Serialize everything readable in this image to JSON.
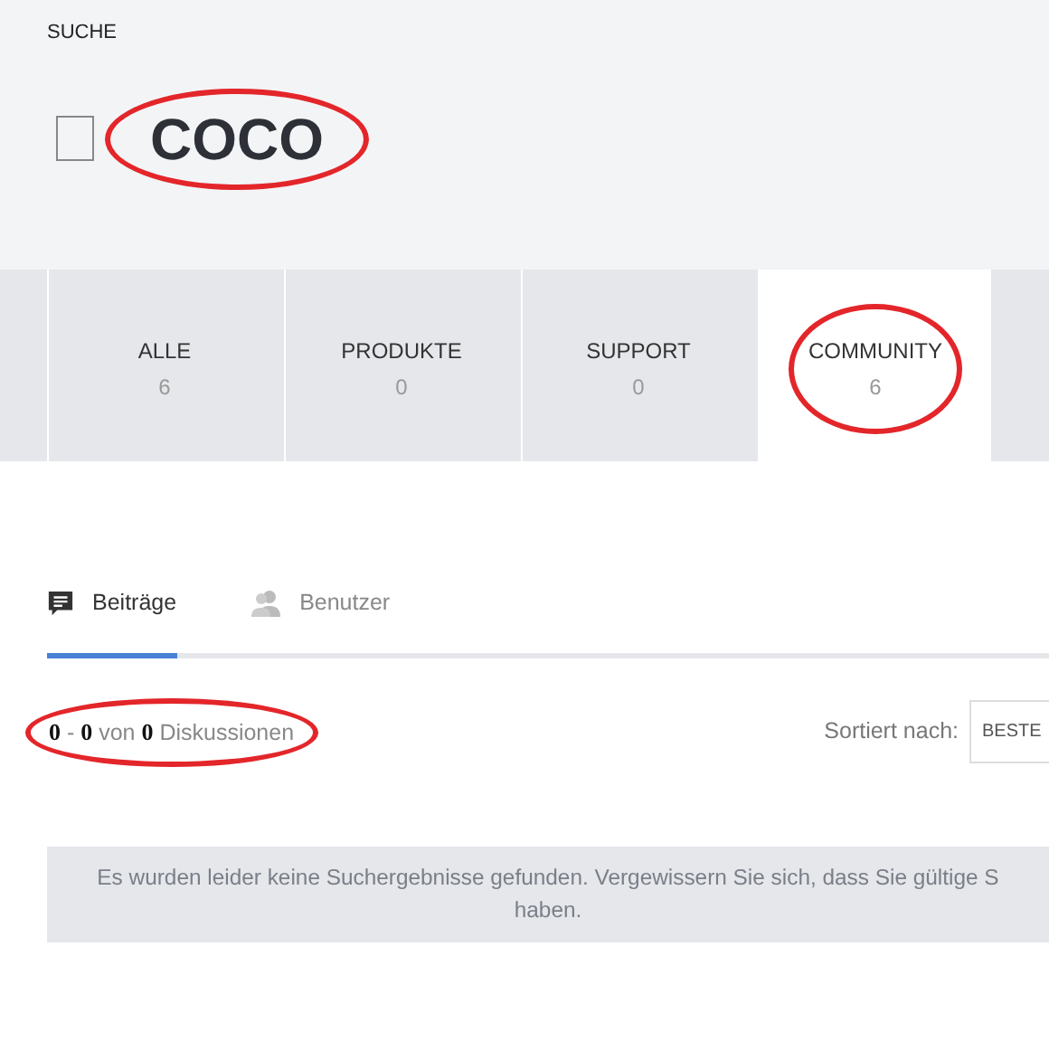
{
  "header": {
    "label": "SUCHE",
    "query": "COCO",
    "query_circled": true
  },
  "tabs": [
    {
      "label": "ALLE",
      "count": "6",
      "selected": false,
      "circled": false
    },
    {
      "label": "PRODUKTE",
      "count": "0",
      "selected": false,
      "circled": false
    },
    {
      "label": "SUPPORT",
      "count": "0",
      "selected": false,
      "circled": false
    },
    {
      "label": "COMMUNITY",
      "count": "6",
      "selected": true,
      "circled": true
    }
  ],
  "subtabs": [
    {
      "label": "Beiträge",
      "kind": "posts",
      "selected": true
    },
    {
      "label": "Benutzer",
      "kind": "users",
      "selected": false
    }
  ],
  "results": {
    "count": "**0** - **0** von **0** Diskussionen",
    "count_circled": true,
    "sort_label": "Sortiert nach:",
    "sort_value": "BESTE"
  },
  "message": {
    "lines": [
      "Es wurden leider keine Suchergebnisse gefunden. Vergewissern Sie sich, dass Sie gültige S",
      "haben."
    ]
  }
}
